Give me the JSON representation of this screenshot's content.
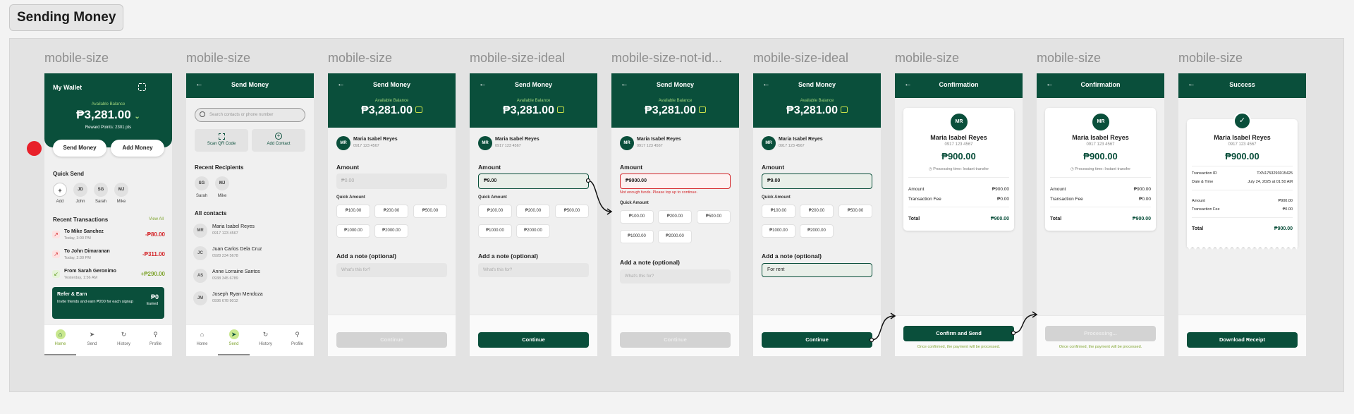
{
  "section_title": "Sending Money",
  "frames": [
    {
      "label": "mobile-size"
    },
    {
      "label": "mobile-size"
    },
    {
      "label": "mobile-size"
    },
    {
      "label": "mobile-size-ideal"
    },
    {
      "label": "mobile-size-not-id..."
    },
    {
      "label": "mobile-size-ideal"
    },
    {
      "label": "mobile-size"
    },
    {
      "label": "mobile-size"
    },
    {
      "label": "mobile-size"
    }
  ],
  "wallet": {
    "title": "My Wallet",
    "available_label": "Available Balance",
    "balance": "₱3,281.00",
    "chevron": "⌄",
    "reward": "Reward Points: 2301 pts",
    "send_btn": "Send Money",
    "add_btn": "Add Money",
    "quick_send": "Quick Send",
    "quick": [
      {
        "initials": "+",
        "name": "Add"
      },
      {
        "initials": "JD",
        "name": "John"
      },
      {
        "initials": "SG",
        "name": "Sarah"
      },
      {
        "initials": "MJ",
        "name": "Mike"
      }
    ],
    "recent_title": "Recent Transactions",
    "view_all": "View All",
    "transactions": [
      {
        "title": "To Mike Sanchez",
        "date": "Today, 3:00 PM",
        "amount": "-₱80.00",
        "type": "out"
      },
      {
        "title": "To John Dimaranan",
        "date": "Today, 2:30 PM",
        "amount": "-₱311.00",
        "type": "out"
      },
      {
        "title": "From Sarah Geronimo",
        "date": "Yesterday, 1:56 AM",
        "amount": "+₱290.00",
        "type": "in"
      }
    ],
    "refer_title": "Refer & Earn",
    "refer_text": "Invite friends and earn ₱200 for each signup",
    "refer_amount": "₱0",
    "refer_earned": "Earned"
  },
  "nav": [
    "Home",
    "Send",
    "History",
    "Profile"
  ],
  "send": {
    "title": "Send Money",
    "search_placeholder": "Search contacts or phone number",
    "scan": "Scan QR Code",
    "add_contact": "Add Contact",
    "recent": "Recent Recipients",
    "recents": [
      {
        "initials": "SG",
        "name": "Sarah"
      },
      {
        "initials": "MJ",
        "name": "Mike"
      }
    ],
    "all_contacts": "All contacts",
    "contacts": [
      {
        "initials": "MR",
        "name": "Maria Isabel Reyes",
        "phone": "0917 123 4567"
      },
      {
        "initials": "JC",
        "name": "Juan Carlos Dela Cruz",
        "phone": "0928 234 5678"
      },
      {
        "initials": "AS",
        "name": "Anne Lorraine Santos",
        "phone": "0938 345 6789"
      },
      {
        "initials": "JM",
        "name": "Joseph Ryan Mendoza",
        "phone": "0936 678 9012"
      }
    ]
  },
  "amount_form": {
    "title": "Send Money",
    "available_label": "Available Balance",
    "balance": "₱3,281.00",
    "recipient_initials": "MR",
    "recipient": "Maria Isabel Reyes",
    "phone": "0917 123 4567",
    "amount_label": "Amount",
    "amount_placeholder": "₱0.00",
    "quick_label": "Quick Amount",
    "chips": [
      "₱100.00",
      "₱200.00",
      "₱500.00",
      "₱1000.00",
      "₱2000.00"
    ],
    "note_label": "Add a note (optional)",
    "note_placeholder": "What's this for?",
    "continue": "Continue",
    "amount_valid": "₱9.00",
    "amount_invalid": "₱9000.00",
    "error": "Not enough funds. Please top up to continue.",
    "note_value": "For rent"
  },
  "confirm": {
    "title": "Confirmation",
    "initials": "MR",
    "name": "Maria Isabel Reyes",
    "phone": "0917 123 4567",
    "amount": "₱900.00",
    "processing": "Processing time: Instant transfer",
    "rows": [
      {
        "k": "Amount",
        "v": "₱900.00"
      },
      {
        "k": "Transaction Fee",
        "v": "₱0.00"
      }
    ],
    "total_label": "Total",
    "total": "₱900.00",
    "btn": "Confirm and Send",
    "btn_processing": "Processing...",
    "footnote": "Once confirmed, the payment will be processed."
  },
  "success": {
    "title": "Success",
    "name": "Maria Isabel Reyes",
    "phone": "0917 123 4567",
    "amount": "₱900.00",
    "rows": [
      {
        "k": "Transaction ID",
        "v": "TXN1753293015425"
      },
      {
        "k": "Date & Time",
        "v": "July 24, 2025 at 01:50 AM"
      }
    ],
    "rows2": [
      {
        "k": "Amount",
        "v": "₱900.00"
      },
      {
        "k": "Transaction Fee",
        "v": "₱0.00"
      }
    ],
    "total_label": "Total",
    "total": "₱900.00",
    "btn": "Download Receipt"
  },
  "colors": {
    "brand": "#0a4f3b",
    "accent": "#9dd27a",
    "danger": "#d4262a",
    "marker": "#e8202a"
  }
}
